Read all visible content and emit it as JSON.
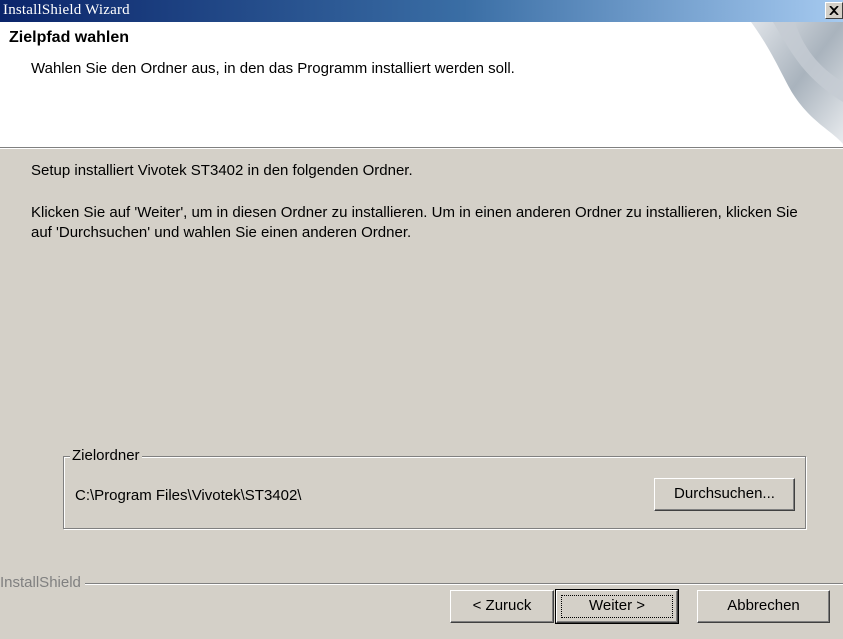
{
  "window": {
    "title": "InstallShield Wizard",
    "close_icon": "close-icon"
  },
  "header": {
    "title": "Zielpfad wahlen",
    "subtitle": "Wahlen Sie den Ordner aus, in den das Programm installiert werden soll."
  },
  "body": {
    "line1": "Setup installiert Vivotek ST3402 in den folgenden Ordner.",
    "line2": "Klicken Sie auf 'Weiter', um in diesen Ordner zu installieren. Um in einen anderen Ordner zu installieren, klicken Sie auf 'Durchsuchen' und wahlen Sie einen anderen Ordner."
  },
  "destination": {
    "group_label": "Zielordner",
    "path": "C:\\Program Files\\Vivotek\\ST3402\\",
    "browse_label": "Durchsuchen..."
  },
  "footer": {
    "brand": "InstallShield",
    "back_label": "< Zuruck",
    "next_label": "Weiter >",
    "cancel_label": "Abbrechen"
  }
}
